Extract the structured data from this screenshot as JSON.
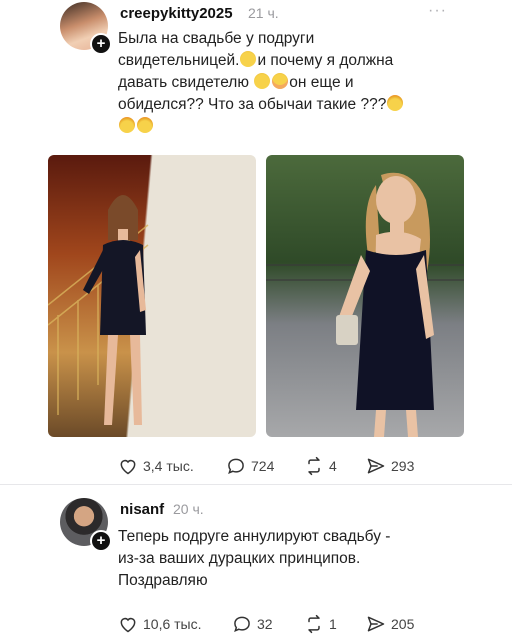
{
  "post1": {
    "username": "creepykitty2025",
    "time": "21 ч.",
    "more": "···",
    "lines": [
      "Была на свадьбе у подруги",
      "свидетельницей.",
      "и почему я должна",
      "давать свидетелю",
      "он еще и",
      "обиделся?? Что за обычаи такие ???"
    ],
    "stats": {
      "likes": "3,4 тыс.",
      "comments": "724",
      "reposts": "4",
      "shares": "293"
    }
  },
  "post2": {
    "username": "nisanf",
    "time": "20 ч.",
    "lines": [
      "Теперь подруге аннулируют свадьбу -",
      "из-за ваших дурацких принципов.",
      "Поздравляю"
    ],
    "stats": {
      "likes": "10,6 тыс.",
      "comments": "32",
      "reposts": "1",
      "shares": "205"
    }
  },
  "icons": {
    "like": "heart-icon",
    "comment": "comment-icon",
    "repost": "repost-icon",
    "share": "share-icon",
    "follow": "plus-icon"
  },
  "colors": {
    "accent": "#111111",
    "muted": "#9a9a9e"
  }
}
